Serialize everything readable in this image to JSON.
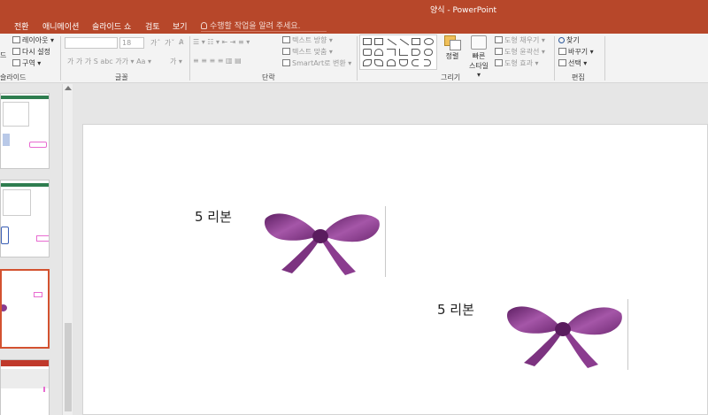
{
  "window": {
    "title": "양식 - PowerPoint"
  },
  "tabs": [
    "전환",
    "애니메이션",
    "슬라이드 쇼",
    "검토",
    "보기"
  ],
  "tell_me": {
    "placeholder": "수행할 작업을 알려 주세요."
  },
  "ribbon": {
    "slides_group": {
      "layout": "레이아웃 ▾",
      "reset": "다시 설정",
      "section": "구역 ▾",
      "new_slide_partial": "드",
      "label": "슬라이드"
    },
    "font_group": {
      "size": "18",
      "label": "글꼴",
      "row2": "가  가  가  S  abc  가가 ▾  Aa ▾"
    },
    "paragraph_group": {
      "text_direction": "텍스트 방향 ▾",
      "align_text": "텍스트 맞춤 ▾",
      "smartart": "SmartArt로 변환 ▾",
      "label": "단락"
    },
    "drawing_group": {
      "arrange": "정렬",
      "quick_styles_1": "빠른",
      "quick_styles_2": "스타일 ▾",
      "shape_fill": "도형 채우기 ▾",
      "shape_outline": "도형 윤곽선 ▾",
      "shape_effects": "도형 효과 ▾",
      "label": "그리기"
    },
    "editing_group": {
      "find": "찾기",
      "replace": "바꾸기 ▾",
      "select": "선택 ▾",
      "label": "편집"
    }
  },
  "slide": {
    "captions": [
      "5 리본",
      "5 리본"
    ]
  },
  "colors": {
    "accent": "#b7472a",
    "selection": "#d35230",
    "ribbon_purple": "#8a3b8c"
  }
}
